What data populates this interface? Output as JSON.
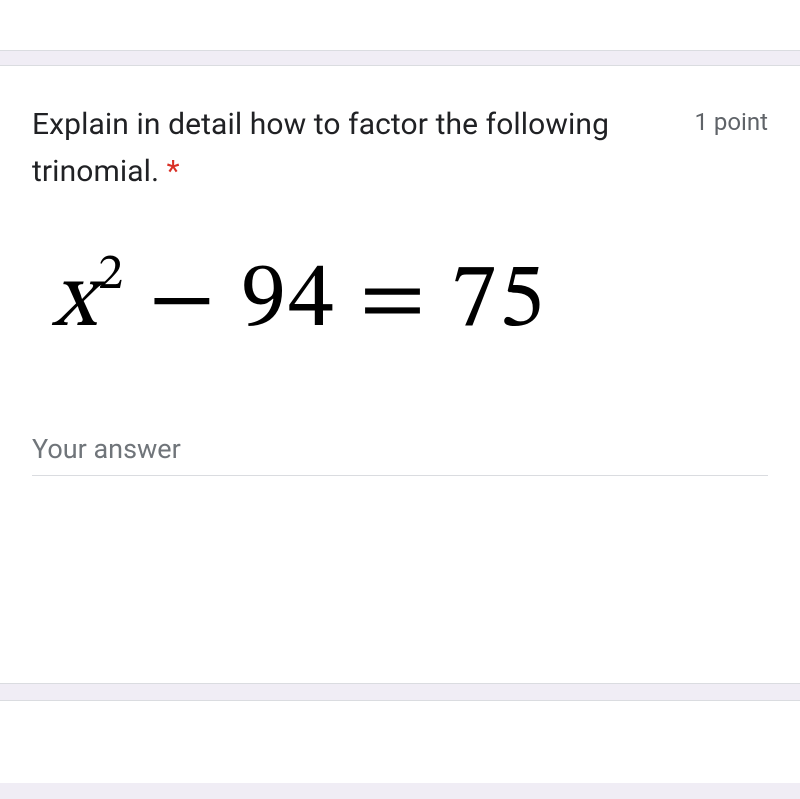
{
  "question": {
    "prompt": "Explain in detail how to factor the following trinomial.",
    "required_marker": "*",
    "points_label": "1 point"
  },
  "equation": {
    "variable": "x",
    "exponent": "2",
    "term_operator": "−",
    "constant": "94",
    "equals": "=",
    "rhs": "75"
  },
  "answer": {
    "placeholder": "Your answer",
    "value": ""
  }
}
